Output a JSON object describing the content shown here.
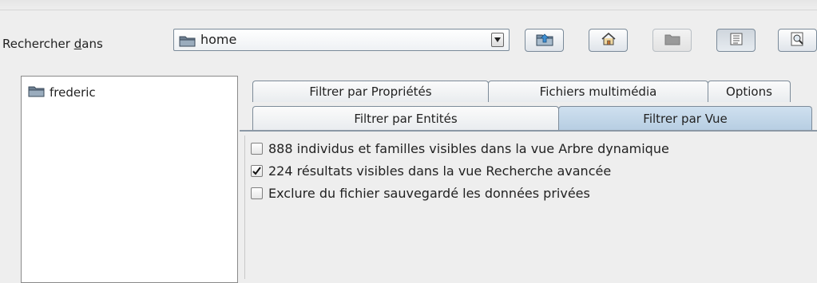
{
  "look_in": {
    "label_prefix": "Rechercher ",
    "label_mnemonic": "d",
    "label_suffix": "ans",
    "value": "home"
  },
  "toolbar": {
    "icons": [
      "up-folder-icon",
      "home-icon",
      "new-folder-icon",
      "list-view-icon",
      "details-view-icon"
    ]
  },
  "file_list": {
    "items": [
      {
        "name": "frederic",
        "icon": "folder-icon"
      }
    ]
  },
  "tabs": {
    "row1": [
      {
        "label": "Filtrer par Propriétés"
      },
      {
        "label": "Fichiers multimédia"
      },
      {
        "label": "Options"
      }
    ],
    "row2": [
      {
        "label": "Filtrer par Entités"
      },
      {
        "label": "Filtrer par Vue",
        "selected": true
      }
    ]
  },
  "filter_view": {
    "options": [
      {
        "label": "888 individus et familles visibles dans la vue Arbre dynamique",
        "checked": false
      },
      {
        "label": "224 résultats visibles dans la vue Recherche avancée",
        "checked": true
      },
      {
        "label": "Exclure du fichier sauvegardé les données privées",
        "checked": false
      }
    ]
  },
  "colors": {
    "selected_tab": "#b6cde2",
    "accent_border": "#7a8a99",
    "background": "#eeeeee"
  }
}
